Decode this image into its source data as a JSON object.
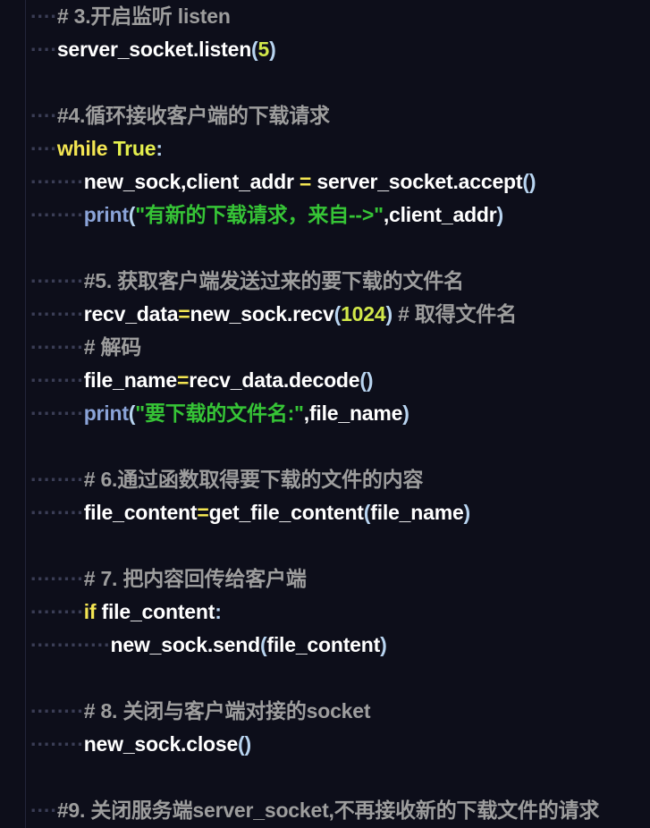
{
  "editor": {
    "language": "python",
    "theme": "dark-navy",
    "background_color": "#0d0e1a",
    "render_whitespace": true,
    "word_wrap": true,
    "colors": {
      "comment": "#9d9d9d",
      "keyword": "#f3e552",
      "boolean": "#e4ef4d",
      "string": "#36c436",
      "number": "#d2e84a",
      "function": "#8aa3d8",
      "operator": "#f3e552",
      "punctuation": "#b8d4f0",
      "identifier": "#ffffff",
      "whitespace_dot": "#3a3d55",
      "indent_guide": "#23253a"
    }
  },
  "lines": [
    {
      "id": "line-comment-3",
      "indent_dots": "····",
      "tokens": [
        {
          "t": "cmt",
          "v": "# 3.开启监听 listen"
        }
      ]
    },
    {
      "id": "line-listen-call",
      "indent_dots": "····",
      "tokens": [
        {
          "t": "id",
          "v": "server_socket.listen"
        },
        {
          "t": "pun",
          "v": "("
        },
        {
          "t": "num",
          "v": "5"
        },
        {
          "t": "pun",
          "v": ")"
        }
      ]
    },
    {
      "id": "line-blank-1",
      "indent_dots": "",
      "tokens": []
    },
    {
      "id": "line-comment-4",
      "indent_dots": "····",
      "tokens": [
        {
          "t": "cmt",
          "v": "#4.循环接收客户端的下载请求"
        }
      ]
    },
    {
      "id": "line-while-true",
      "indent_dots": "····",
      "tokens": [
        {
          "t": "kw",
          "v": "while"
        },
        {
          "t": "id",
          "v": " "
        },
        {
          "t": "bool",
          "v": "True"
        },
        {
          "t": "pun",
          "v": ":"
        }
      ]
    },
    {
      "id": "line-accept",
      "indent_dots": "········",
      "tokens": [
        {
          "t": "id",
          "v": "new_sock,client_addr "
        },
        {
          "t": "op",
          "v": "="
        },
        {
          "t": "id",
          "v": " server_socket.accept"
        },
        {
          "t": "pun",
          "v": "()"
        }
      ]
    },
    {
      "id": "line-print-new-request",
      "indent_dots": "········",
      "tokens": [
        {
          "t": "fn",
          "v": "print"
        },
        {
          "t": "pun",
          "v": "("
        },
        {
          "t": "str",
          "v": "\"有新的下载请求，来自-->\""
        },
        {
          "t": "id",
          "v": ",client_addr"
        },
        {
          "t": "pun",
          "v": ")"
        }
      ]
    },
    {
      "id": "line-blank-2",
      "indent_dots": "",
      "tokens": []
    },
    {
      "id": "line-comment-5",
      "indent_dots": "········",
      "tokens": [
        {
          "t": "cmt",
          "v": "#5. 获取客户端发送过来的要下载的文件名"
        }
      ]
    },
    {
      "id": "line-recv-data",
      "indent_dots": "········",
      "tokens": [
        {
          "t": "id",
          "v": "recv_data"
        },
        {
          "t": "op",
          "v": "="
        },
        {
          "t": "id",
          "v": "new_sock.recv"
        },
        {
          "t": "pun",
          "v": "("
        },
        {
          "t": "num",
          "v": "1024"
        },
        {
          "t": "pun",
          "v": ")"
        },
        {
          "t": "cmt",
          "v": " # 取得文件名"
        }
      ]
    },
    {
      "id": "line-comment-decode",
      "indent_dots": "········",
      "tokens": [
        {
          "t": "cmt",
          "v": "# 解码"
        }
      ]
    },
    {
      "id": "line-file-name-decode",
      "indent_dots": "········",
      "tokens": [
        {
          "t": "id",
          "v": "file_name"
        },
        {
          "t": "op",
          "v": "="
        },
        {
          "t": "id",
          "v": "recv_data.decode"
        },
        {
          "t": "pun",
          "v": "()"
        }
      ]
    },
    {
      "id": "line-print-file-name",
      "indent_dots": "········",
      "tokens": [
        {
          "t": "fn",
          "v": "print"
        },
        {
          "t": "pun",
          "v": "("
        },
        {
          "t": "str",
          "v": "\"要下载的文件名:\""
        },
        {
          "t": "id",
          "v": ",file_name"
        },
        {
          "t": "pun",
          "v": ")"
        }
      ]
    },
    {
      "id": "line-blank-3",
      "indent_dots": "",
      "tokens": []
    },
    {
      "id": "line-comment-6",
      "indent_dots": "········",
      "tokens": [
        {
          "t": "cmt",
          "v": "# 6.通过函数取得要下载的文件的内容"
        }
      ]
    },
    {
      "id": "line-get-file-content",
      "indent_dots": "········",
      "tokens": [
        {
          "t": "id",
          "v": "file_content"
        },
        {
          "t": "op",
          "v": "="
        },
        {
          "t": "id",
          "v": "get_file_content"
        },
        {
          "t": "pun",
          "v": "("
        },
        {
          "t": "id",
          "v": "file_name"
        },
        {
          "t": "pun",
          "v": ")"
        }
      ]
    },
    {
      "id": "line-blank-4",
      "indent_dots": "",
      "tokens": []
    },
    {
      "id": "line-comment-7",
      "indent_dots": "········",
      "tokens": [
        {
          "t": "cmt",
          "v": "# 7. 把内容回传给客户端"
        }
      ]
    },
    {
      "id": "line-if-file-content",
      "indent_dots": "········",
      "tokens": [
        {
          "t": "kw",
          "v": "if"
        },
        {
          "t": "id",
          "v": " file_content"
        },
        {
          "t": "pun",
          "v": ":"
        }
      ]
    },
    {
      "id": "line-send-content",
      "indent_dots": "············",
      "tokens": [
        {
          "t": "id",
          "v": "new_sock.send"
        },
        {
          "t": "pun",
          "v": "("
        },
        {
          "t": "id",
          "v": "file_content"
        },
        {
          "t": "pun",
          "v": ")"
        }
      ]
    },
    {
      "id": "line-blank-5",
      "indent_dots": "",
      "tokens": []
    },
    {
      "id": "line-comment-8",
      "indent_dots": "········",
      "tokens": [
        {
          "t": "cmt",
          "v": "# 8. 关闭与客户端对接的socket"
        }
      ]
    },
    {
      "id": "line-close-new-sock",
      "indent_dots": "········",
      "tokens": [
        {
          "t": "id",
          "v": "new_sock.close"
        },
        {
          "t": "pun",
          "v": "()"
        }
      ]
    },
    {
      "id": "line-blank-6",
      "indent_dots": "",
      "tokens": []
    },
    {
      "id": "line-comment-9",
      "indent_dots": "····",
      "tokens": [
        {
          "t": "cmt",
          "v": "#9. 关闭服务端server_socket,不再接收新的下载文件的请求"
        }
      ]
    }
  ]
}
